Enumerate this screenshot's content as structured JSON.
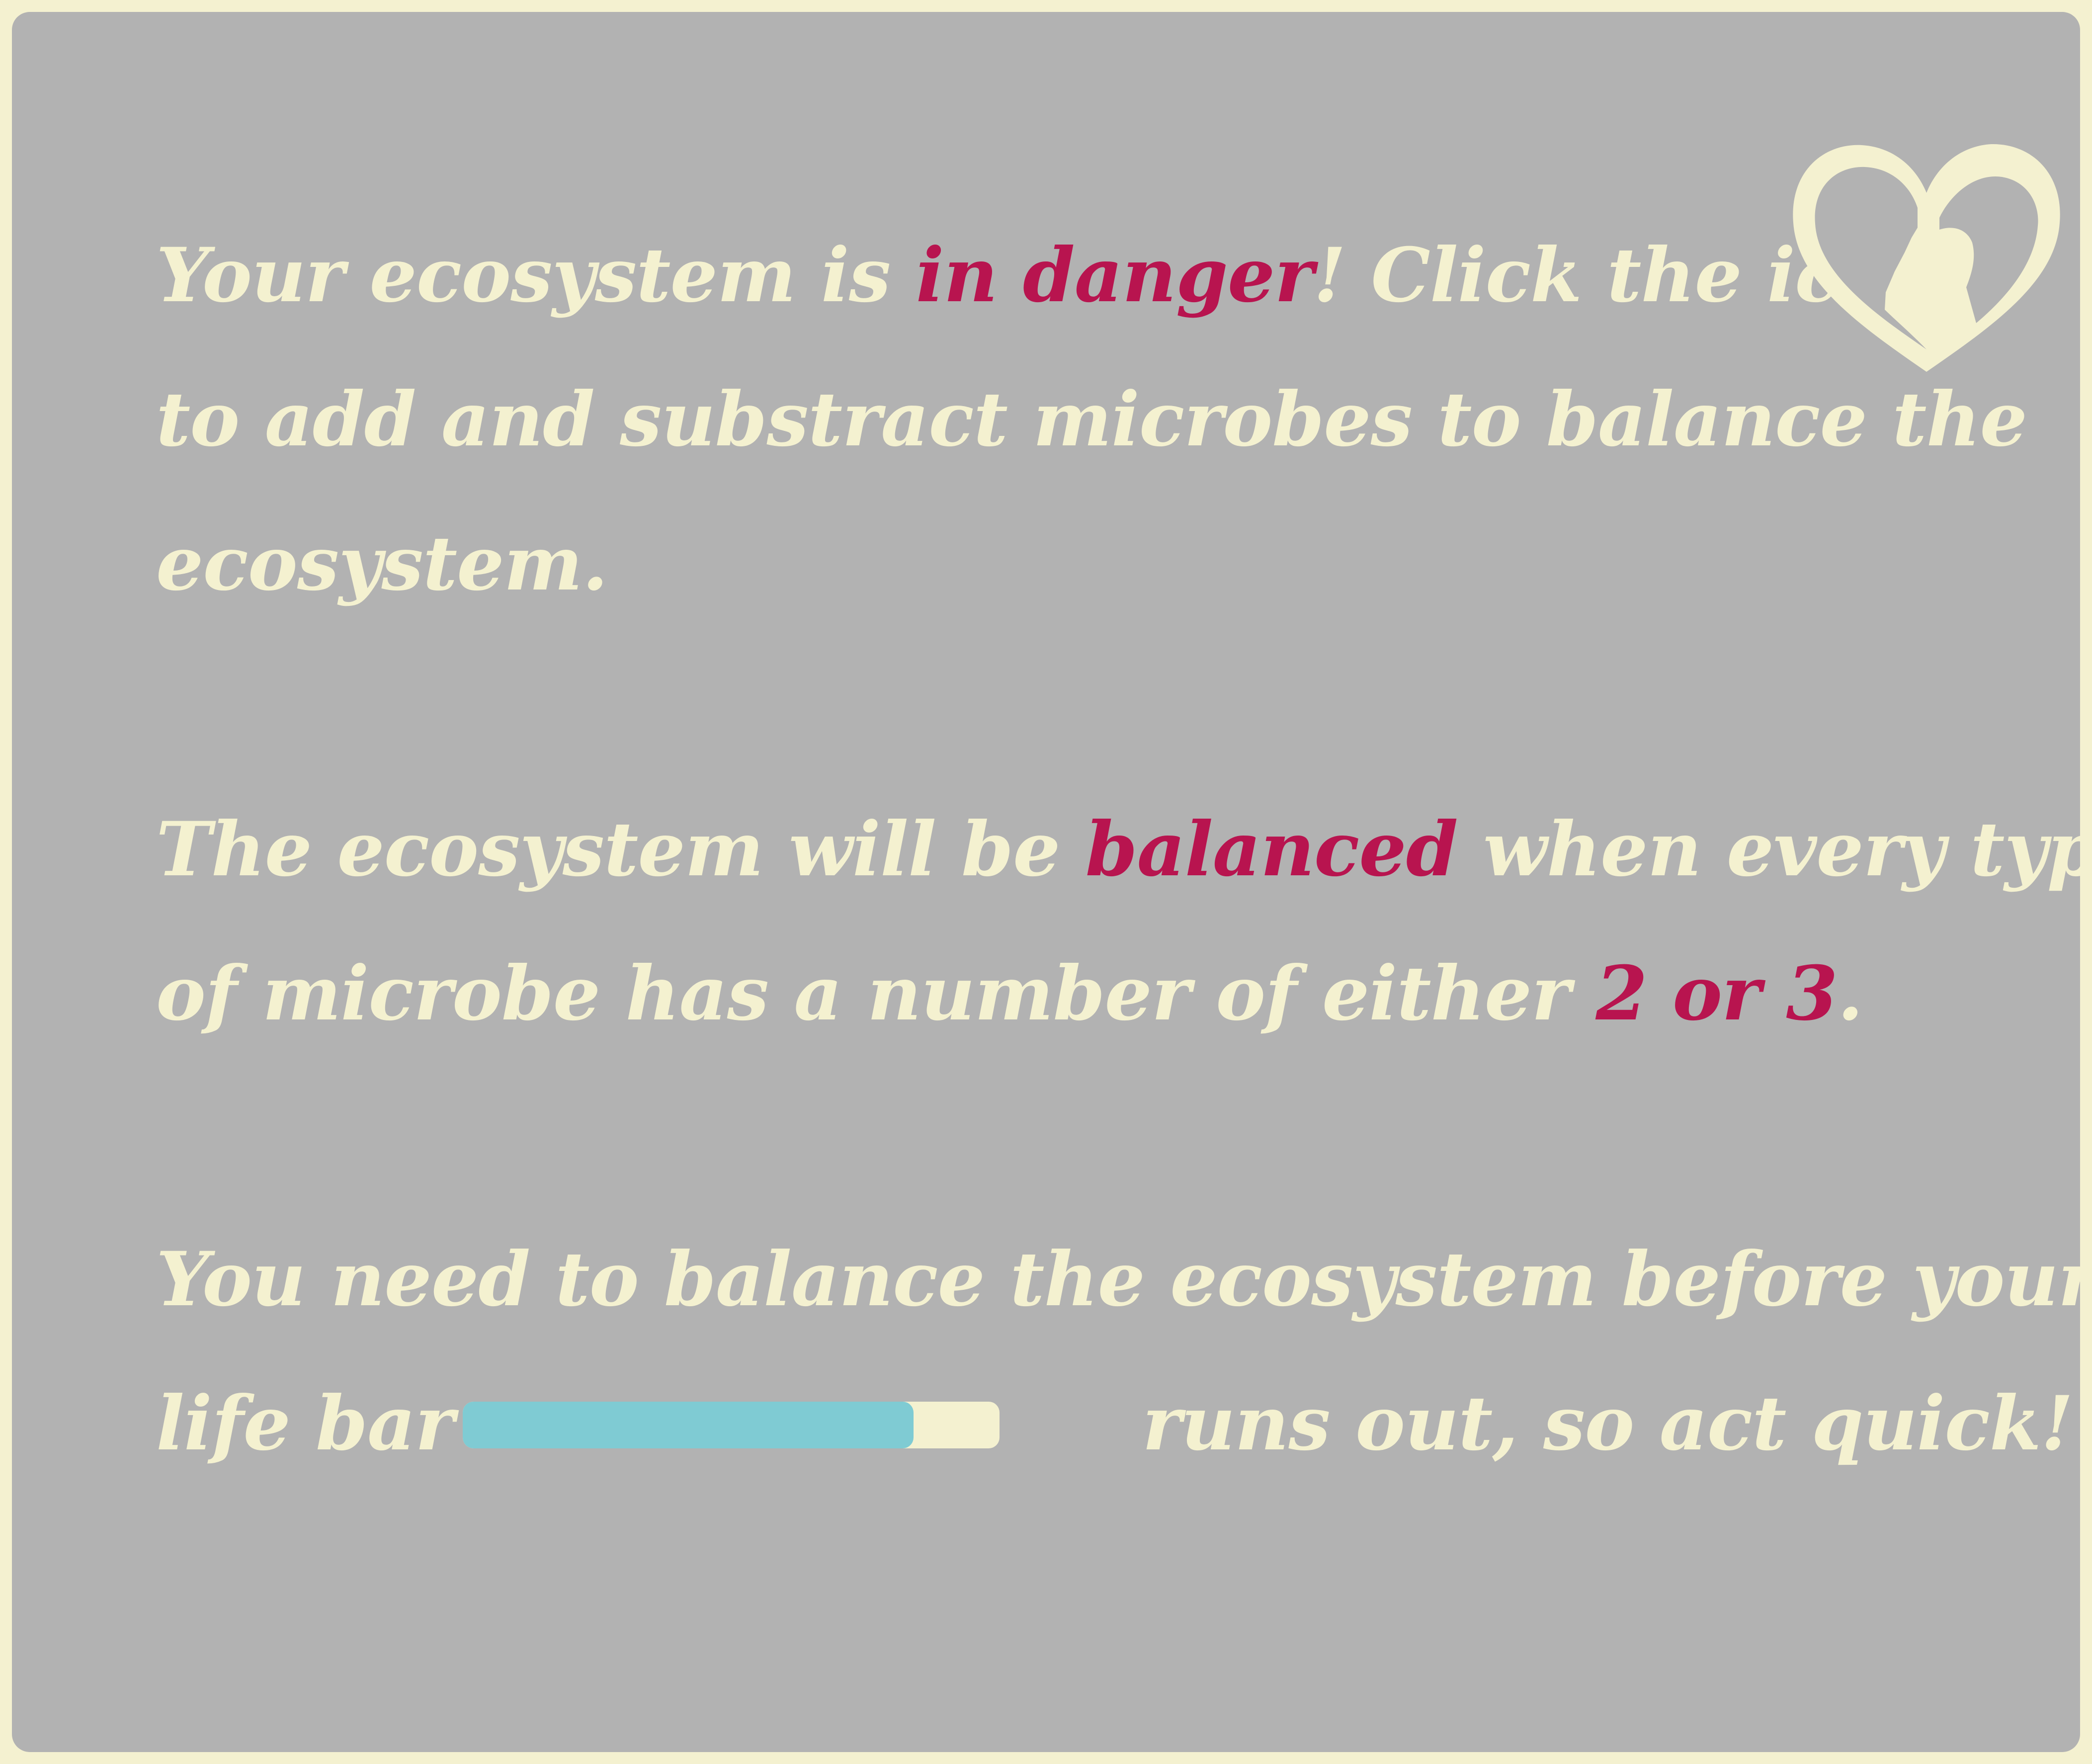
{
  "instructions": {
    "p1": {
      "l1_a": "Your ecosystem is ",
      "l1_hl": "in danger",
      "l1_b": "! Click the icons",
      "l2": " to add and substract microbes to balance the",
      "l3": "ecosystem."
    },
    "p2": {
      "l1_a": "The ecosystem will be ",
      "l1_hl": "balanced",
      "l1_b": " when every type",
      "l2_a": "of microbe has a number of either ",
      "l2_hl": "2 or 3",
      "l2_b": "."
    },
    "p3": {
      "l1": "You need to balance the ecosystem before your",
      "l2_a": "life bar",
      "l2_b": "runs out, so act quick!"
    }
  },
  "life_bar": {
    "level": 0.84,
    "fill_color": "#7fcbd3",
    "track_color": "#f4f1d0"
  },
  "colors": {
    "background": "#b2b2b2",
    "text": "#f4f1d0",
    "highlight": "#b8144f",
    "border": "#f4f1d0"
  },
  "icons": {
    "logo": "heart-silhouette-icon"
  }
}
